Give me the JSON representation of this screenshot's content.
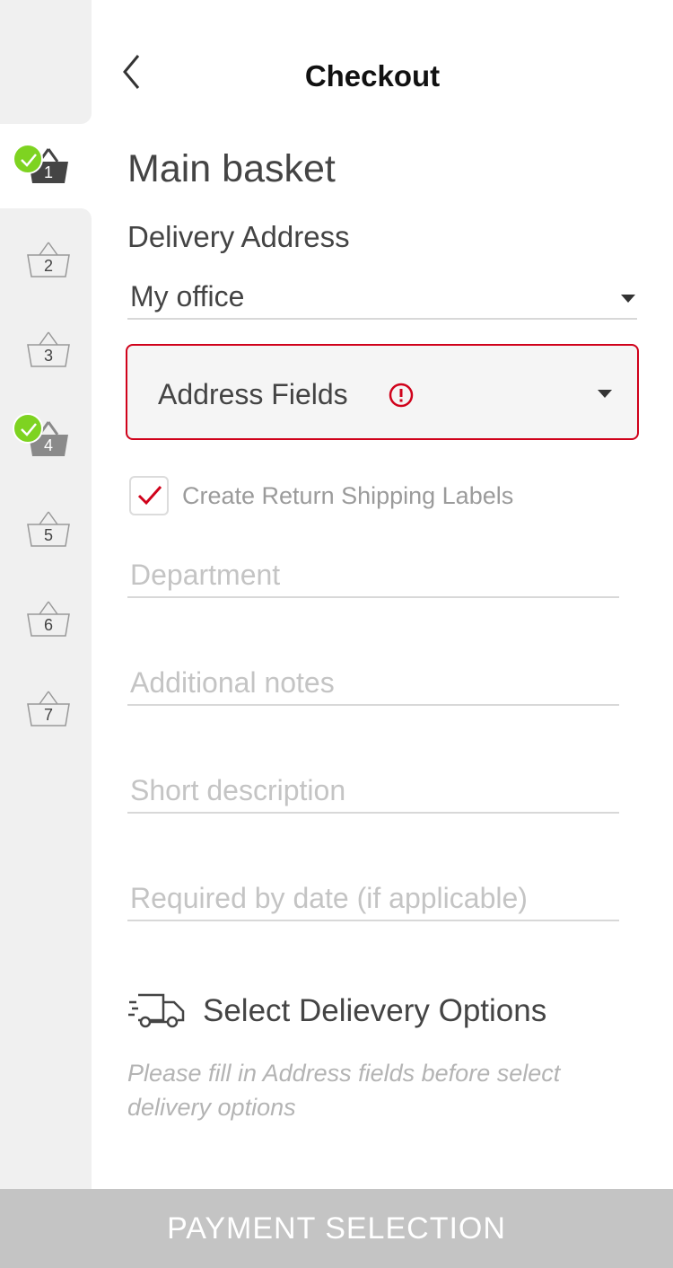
{
  "header": {
    "title": "Checkout",
    "back_icon": "chevron-left-icon"
  },
  "sidebar": {
    "baskets": [
      {
        "number": "1",
        "state": "active-complete"
      },
      {
        "number": "2",
        "state": "empty"
      },
      {
        "number": "3",
        "state": "empty"
      },
      {
        "number": "4",
        "state": "complete"
      },
      {
        "number": "5",
        "state": "empty"
      },
      {
        "number": "6",
        "state": "empty"
      },
      {
        "number": "7",
        "state": "empty"
      }
    ]
  },
  "main": {
    "basket_title": "Main basket",
    "delivery_heading": "Delivery Address",
    "address_select": {
      "value": "My office"
    },
    "address_fields": {
      "label": "Address Fields",
      "status_icon": "warning-icon"
    },
    "return_labels": {
      "label": "Create Return Shipping Labels",
      "checked": true
    },
    "fields": [
      {
        "placeholder": "Department",
        "value": ""
      },
      {
        "placeholder": "Additional notes",
        "value": ""
      },
      {
        "placeholder": "Short description",
        "value": ""
      },
      {
        "placeholder": "Required by date (if applicable)",
        "value": ""
      }
    ],
    "delivery_options": {
      "title": "Select Delievery Options",
      "icon": "truck-icon",
      "note": "Please fill in Address fields before select delivery options"
    }
  },
  "footer": {
    "button_label": "PAYMENT SELECTION"
  },
  "colors": {
    "accent_red": "#d0021b",
    "check_green": "#7ed321",
    "disabled_button": "#c4c4c4",
    "sidebar_bg": "#f0f0f0"
  }
}
